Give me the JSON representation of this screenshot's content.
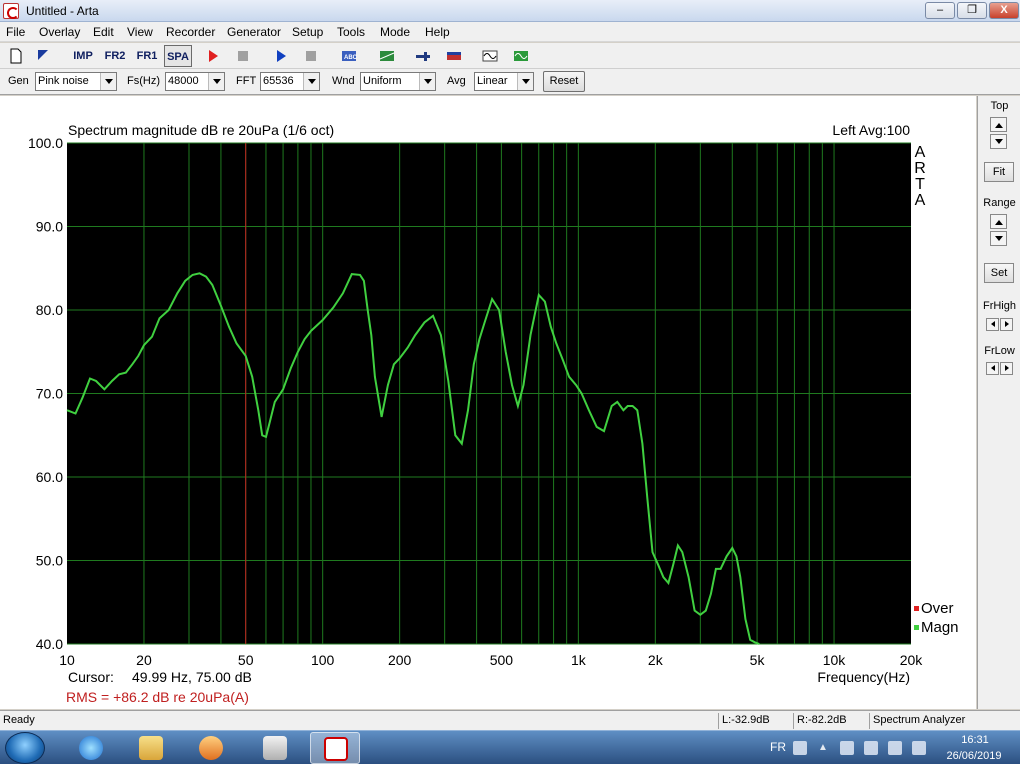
{
  "window": {
    "title": "Untitled - Arta",
    "min": "–",
    "max": "❐",
    "close": "X"
  },
  "menu": [
    "File",
    "Overlay",
    "Edit",
    "View",
    "Recorder",
    "Generator",
    "Setup",
    "Tools",
    "Mode",
    "Help"
  ],
  "toolbar": {
    "imp": "IMP",
    "fr2": "FR2",
    "fr1": "FR1",
    "spa": "SPA"
  },
  "controls": {
    "gen_label": "Gen",
    "gen_value": "Pink noise",
    "fs_label": "Fs(Hz)",
    "fs_value": "48000",
    "fft_label": "FFT",
    "fft_value": "65536",
    "wnd_label": "Wnd",
    "wnd_value": "Uniform",
    "avg_label": "Avg",
    "avg_value": "Linear",
    "reset": "Reset"
  },
  "right_panel": {
    "top": "Top",
    "fit": "Fit",
    "range": "Range",
    "set": "Set",
    "frhigh": "FrHigh",
    "frlow": "FrLow"
  },
  "chart_data": {
    "type": "line",
    "title": "Spectrum magnitude dB re 20uPa (1/6 oct)",
    "channel_info": "Left  Avg:100",
    "xlabel": "Frequency(Hz)",
    "x_scale": "log",
    "xlim": [
      10,
      20000
    ],
    "ylim": [
      40,
      100
    ],
    "x_ticks": [
      10,
      20,
      50,
      100,
      200,
      500,
      1000,
      2000,
      5000,
      10000,
      20000
    ],
    "x_tick_labels": [
      "10",
      "20",
      "50",
      "100",
      "200",
      "500",
      "1k",
      "2k",
      "5k",
      "10k",
      "20k"
    ],
    "y_ticks": [
      100,
      90,
      80,
      70,
      60,
      50,
      40
    ],
    "y_tick_labels": [
      "100.0",
      "90.0",
      "80.0",
      "70.0",
      "60.0",
      "50.0",
      "40.0"
    ],
    "watermark": [
      "A",
      "R",
      "T",
      "A"
    ],
    "cursor": {
      "label": "Cursor:",
      "text": "49.99 Hz, 75.00 dB",
      "freq": 49.99,
      "color": "#c02020"
    },
    "rms": "RMS =  +86.2 dB re 20uPa(A)",
    "legend": [
      {
        "name": "Over",
        "color": "#e02020"
      },
      {
        "name": "Magn",
        "color": "#40d040"
      }
    ],
    "background": "#000000",
    "grid_color": "#1f7a1f",
    "series": [
      {
        "name": "Magn",
        "color": "#40d040",
        "x": [
          10,
          10.8,
          11.5,
          12.3,
          13,
          14,
          15,
          16,
          17,
          18,
          19,
          20,
          21.5,
          23,
          25,
          27,
          29,
          31,
          33,
          35,
          37,
          40,
          43,
          46,
          50,
          53,
          56,
          58,
          60,
          62,
          65,
          70,
          75,
          80,
          85,
          90,
          100,
          110,
          120,
          130,
          140,
          145,
          150,
          155,
          160,
          170,
          180,
          190,
          200,
          215,
          230,
          250,
          270,
          290,
          310,
          330,
          350,
          370,
          390,
          410,
          430,
          460,
          490,
          520,
          550,
          580,
          610,
          650,
          700,
          740,
          780,
          820,
          870,
          920,
          980,
          1030,
          1100,
          1180,
          1260,
          1350,
          1420,
          1500,
          1560,
          1630,
          1700,
          1780,
          1860,
          1950,
          2050,
          2150,
          2250,
          2350,
          2450,
          2550,
          2700,
          2850,
          3000,
          3150,
          3300,
          3450,
          3600,
          3800,
          4000,
          4150,
          4300,
          4500,
          4700,
          4900,
          5100
        ],
        "y": [
          68,
          67.6,
          69.5,
          71.8,
          71.5,
          70.5,
          71.5,
          72.3,
          72.5,
          73.5,
          74.5,
          75.8,
          76.8,
          79,
          80,
          82,
          83.5,
          84.2,
          84.4,
          84,
          83,
          80.5,
          78,
          76,
          74.5,
          72,
          68,
          65,
          64.8,
          66.5,
          69,
          70.5,
          73,
          75,
          76.5,
          77.5,
          78.8,
          80.3,
          82,
          84.3,
          84.2,
          83.5,
          80,
          77,
          72,
          67.2,
          71,
          73.5,
          74.2,
          75.5,
          77,
          78.5,
          79.3,
          77,
          71.5,
          65,
          64,
          68,
          73.5,
          76.5,
          78.5,
          81.3,
          80,
          75,
          71,
          68.5,
          71,
          77,
          81.8,
          81,
          78,
          76,
          74,
          72,
          71,
          70,
          68,
          66,
          65.5,
          68.5,
          69,
          68,
          68.5,
          68.5,
          68,
          64,
          57.5,
          51,
          49.5,
          48,
          47.3,
          49.5,
          51.8,
          51,
          48,
          44,
          43.5,
          44,
          46,
          49,
          49,
          50.5,
          51.5,
          50.5,
          48,
          43,
          40.5,
          40.2,
          39.8
        ]
      }
    ]
  },
  "status": {
    "ready": "Ready",
    "left_level": "L:-32.9dB",
    "right_level": "R:-82.2dB",
    "mode": "Spectrum Analyzer"
  },
  "taskbar": {
    "lang": "FR",
    "time": "16:31",
    "date": "26/06/2019"
  }
}
